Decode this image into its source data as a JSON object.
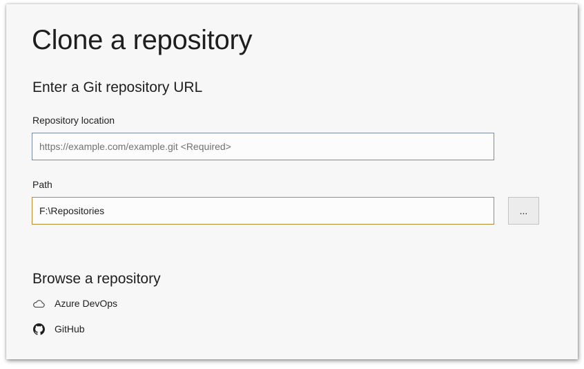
{
  "dialog": {
    "title": "Clone a repository"
  },
  "git_url_section": {
    "heading": "Enter a Git repository URL",
    "repository_location": {
      "label": "Repository location",
      "value": "",
      "placeholder": "https://example.com/example.git <Required>"
    },
    "path": {
      "label": "Path",
      "value": "F:\\Repositories",
      "browse_button_label": "..."
    }
  },
  "browse_section": {
    "heading": "Browse a repository",
    "providers": [
      {
        "label": "Azure DevOps",
        "icon": "cloud-icon"
      },
      {
        "label": "GitHub",
        "icon": "github-icon"
      }
    ]
  },
  "colors": {
    "background": "#f7f7f7",
    "text": "#1e1e1e",
    "focused_border": "#b58a2c",
    "input_border": "#7a8c9e"
  }
}
